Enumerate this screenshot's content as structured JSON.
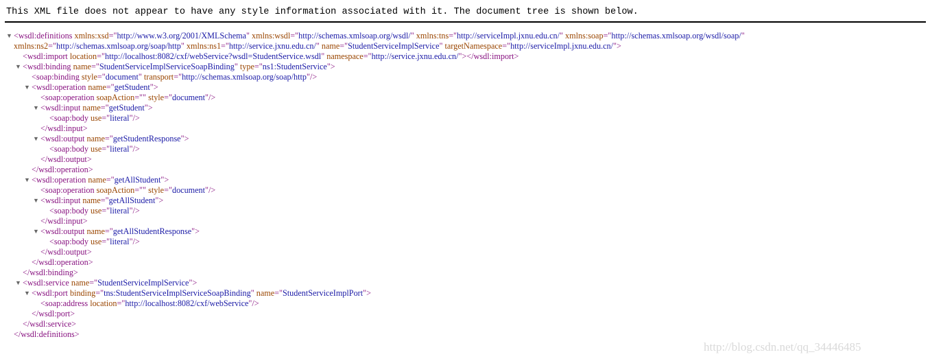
{
  "header": {
    "message": "This XML file does not appear to have any style information associated with it. The document tree is shown below."
  },
  "tree": [
    {
      "indent": 0,
      "toggle": true,
      "parts": [
        [
          "t",
          "<wsdl:definitions"
        ],
        [
          "s",
          " "
        ],
        [
          "a",
          "xmlns:xsd"
        ],
        [
          "t",
          "=\""
        ],
        [
          "v",
          "http://www.w3.org/2001/XMLSchema"
        ],
        [
          "t",
          "\""
        ],
        [
          "s",
          " "
        ],
        [
          "a",
          "xmlns:wsdl"
        ],
        [
          "t",
          "=\""
        ],
        [
          "v",
          "http://schemas.xmlsoap.org/wsdl/"
        ],
        [
          "t",
          "\""
        ],
        [
          "s",
          " "
        ],
        [
          "a",
          "xmlns:tns"
        ],
        [
          "t",
          "=\""
        ],
        [
          "v",
          "http://serviceImpl.jxnu.edu.cn/"
        ],
        [
          "t",
          "\""
        ],
        [
          "s",
          " "
        ],
        [
          "a",
          "xmlns:soap"
        ],
        [
          "t",
          "=\""
        ],
        [
          "v",
          "http://schemas.xmlsoap.org/wsdl/soap/"
        ],
        [
          "t",
          "\""
        ]
      ]
    },
    {
      "indent": 0,
      "toggle": false,
      "parts": [
        [
          "a",
          "xmlns:ns2"
        ],
        [
          "t",
          "=\""
        ],
        [
          "v",
          "http://schemas.xmlsoap.org/soap/http"
        ],
        [
          "t",
          "\""
        ],
        [
          "s",
          " "
        ],
        [
          "a",
          "xmlns:ns1"
        ],
        [
          "t",
          "=\""
        ],
        [
          "v",
          "http://service.jxnu.edu.cn/"
        ],
        [
          "t",
          "\""
        ],
        [
          "s",
          " "
        ],
        [
          "a",
          "name"
        ],
        [
          "t",
          "=\""
        ],
        [
          "v",
          "StudentServiceImplService"
        ],
        [
          "t",
          "\""
        ],
        [
          "s",
          " "
        ],
        [
          "a",
          "targetNamespace"
        ],
        [
          "t",
          "=\""
        ],
        [
          "v",
          "http://serviceImpl.jxnu.edu.cn/"
        ],
        [
          "t",
          "\">"
        ]
      ]
    },
    {
      "indent": 1,
      "toggle": false,
      "parts": [
        [
          "t",
          "<wsdl:import"
        ],
        [
          "s",
          " "
        ],
        [
          "a",
          "location"
        ],
        [
          "t",
          "=\""
        ],
        [
          "v",
          "http://localhost:8082/cxf/webService?wsdl=StudentService.wsdl"
        ],
        [
          "t",
          "\""
        ],
        [
          "s",
          " "
        ],
        [
          "a",
          "namespace"
        ],
        [
          "t",
          "=\""
        ],
        [
          "v",
          "http://service.jxnu.edu.cn/"
        ],
        [
          "t",
          "\"></wsdl:import>"
        ]
      ]
    },
    {
      "indent": 1,
      "toggle": true,
      "parts": [
        [
          "t",
          "<wsdl:binding"
        ],
        [
          "s",
          " "
        ],
        [
          "a",
          "name"
        ],
        [
          "t",
          "=\""
        ],
        [
          "v",
          "StudentServiceImplServiceSoapBinding"
        ],
        [
          "t",
          "\""
        ],
        [
          "s",
          " "
        ],
        [
          "a",
          "type"
        ],
        [
          "t",
          "=\""
        ],
        [
          "v",
          "ns1:StudentService"
        ],
        [
          "t",
          "\">"
        ]
      ]
    },
    {
      "indent": 2,
      "toggle": false,
      "parts": [
        [
          "t",
          "<soap:binding"
        ],
        [
          "s",
          " "
        ],
        [
          "a",
          "style"
        ],
        [
          "t",
          "=\""
        ],
        [
          "v",
          "document"
        ],
        [
          "t",
          "\""
        ],
        [
          "s",
          " "
        ],
        [
          "a",
          "transport"
        ],
        [
          "t",
          "=\""
        ],
        [
          "v",
          "http://schemas.xmlsoap.org/soap/http"
        ],
        [
          "t",
          "\"/>"
        ]
      ]
    },
    {
      "indent": 2,
      "toggle": true,
      "parts": [
        [
          "t",
          "<wsdl:operation"
        ],
        [
          "s",
          " "
        ],
        [
          "a",
          "name"
        ],
        [
          "t",
          "=\""
        ],
        [
          "v",
          "getStudent"
        ],
        [
          "t",
          "\">"
        ]
      ]
    },
    {
      "indent": 3,
      "toggle": false,
      "parts": [
        [
          "t",
          "<soap:operation"
        ],
        [
          "s",
          " "
        ],
        [
          "a",
          "soapAction"
        ],
        [
          "t",
          "=\""
        ],
        [
          "v",
          ""
        ],
        [
          "t",
          "\""
        ],
        [
          "s",
          " "
        ],
        [
          "a",
          "style"
        ],
        [
          "t",
          "=\""
        ],
        [
          "v",
          "document"
        ],
        [
          "t",
          "\"/>"
        ]
      ]
    },
    {
      "indent": 3,
      "toggle": true,
      "parts": [
        [
          "t",
          "<wsdl:input"
        ],
        [
          "s",
          " "
        ],
        [
          "a",
          "name"
        ],
        [
          "t",
          "=\""
        ],
        [
          "v",
          "getStudent"
        ],
        [
          "t",
          "\">"
        ]
      ]
    },
    {
      "indent": 4,
      "toggle": false,
      "parts": [
        [
          "t",
          "<soap:body"
        ],
        [
          "s",
          " "
        ],
        [
          "a",
          "use"
        ],
        [
          "t",
          "=\""
        ],
        [
          "v",
          "literal"
        ],
        [
          "t",
          "\"/>"
        ]
      ]
    },
    {
      "indent": 3,
      "toggle": false,
      "parts": [
        [
          "t",
          "</wsdl:input>"
        ]
      ]
    },
    {
      "indent": 3,
      "toggle": true,
      "parts": [
        [
          "t",
          "<wsdl:output"
        ],
        [
          "s",
          " "
        ],
        [
          "a",
          "name"
        ],
        [
          "t",
          "=\""
        ],
        [
          "v",
          "getStudentResponse"
        ],
        [
          "t",
          "\">"
        ]
      ]
    },
    {
      "indent": 4,
      "toggle": false,
      "parts": [
        [
          "t",
          "<soap:body"
        ],
        [
          "s",
          " "
        ],
        [
          "a",
          "use"
        ],
        [
          "t",
          "=\""
        ],
        [
          "v",
          "literal"
        ],
        [
          "t",
          "\"/>"
        ]
      ]
    },
    {
      "indent": 3,
      "toggle": false,
      "parts": [
        [
          "t",
          "</wsdl:output>"
        ]
      ]
    },
    {
      "indent": 2,
      "toggle": false,
      "parts": [
        [
          "t",
          "</wsdl:operation>"
        ]
      ]
    },
    {
      "indent": 2,
      "toggle": true,
      "parts": [
        [
          "t",
          "<wsdl:operation"
        ],
        [
          "s",
          " "
        ],
        [
          "a",
          "name"
        ],
        [
          "t",
          "=\""
        ],
        [
          "v",
          "getAllStudent"
        ],
        [
          "t",
          "\">"
        ]
      ]
    },
    {
      "indent": 3,
      "toggle": false,
      "parts": [
        [
          "t",
          "<soap:operation"
        ],
        [
          "s",
          " "
        ],
        [
          "a",
          "soapAction"
        ],
        [
          "t",
          "=\""
        ],
        [
          "v",
          ""
        ],
        [
          "t",
          "\""
        ],
        [
          "s",
          " "
        ],
        [
          "a",
          "style"
        ],
        [
          "t",
          "=\""
        ],
        [
          "v",
          "document"
        ],
        [
          "t",
          "\"/>"
        ]
      ]
    },
    {
      "indent": 3,
      "toggle": true,
      "parts": [
        [
          "t",
          "<wsdl:input"
        ],
        [
          "s",
          " "
        ],
        [
          "a",
          "name"
        ],
        [
          "t",
          "=\""
        ],
        [
          "v",
          "getAllStudent"
        ],
        [
          "t",
          "\">"
        ]
      ]
    },
    {
      "indent": 4,
      "toggle": false,
      "parts": [
        [
          "t",
          "<soap:body"
        ],
        [
          "s",
          " "
        ],
        [
          "a",
          "use"
        ],
        [
          "t",
          "=\""
        ],
        [
          "v",
          "literal"
        ],
        [
          "t",
          "\"/>"
        ]
      ]
    },
    {
      "indent": 3,
      "toggle": false,
      "parts": [
        [
          "t",
          "</wsdl:input>"
        ]
      ]
    },
    {
      "indent": 3,
      "toggle": true,
      "parts": [
        [
          "t",
          "<wsdl:output"
        ],
        [
          "s",
          " "
        ],
        [
          "a",
          "name"
        ],
        [
          "t",
          "=\""
        ],
        [
          "v",
          "getAllStudentResponse"
        ],
        [
          "t",
          "\">"
        ]
      ]
    },
    {
      "indent": 4,
      "toggle": false,
      "parts": [
        [
          "t",
          "<soap:body"
        ],
        [
          "s",
          " "
        ],
        [
          "a",
          "use"
        ],
        [
          "t",
          "=\""
        ],
        [
          "v",
          "literal"
        ],
        [
          "t",
          "\"/>"
        ]
      ]
    },
    {
      "indent": 3,
      "toggle": false,
      "parts": [
        [
          "t",
          "</wsdl:output>"
        ]
      ]
    },
    {
      "indent": 2,
      "toggle": false,
      "parts": [
        [
          "t",
          "</wsdl:operation>"
        ]
      ]
    },
    {
      "indent": 1,
      "toggle": false,
      "parts": [
        [
          "t",
          "</wsdl:binding>"
        ]
      ]
    },
    {
      "indent": 1,
      "toggle": true,
      "parts": [
        [
          "t",
          "<wsdl:service"
        ],
        [
          "s",
          " "
        ],
        [
          "a",
          "name"
        ],
        [
          "t",
          "=\""
        ],
        [
          "v",
          "StudentServiceImplService"
        ],
        [
          "t",
          "\">"
        ]
      ]
    },
    {
      "indent": 2,
      "toggle": true,
      "parts": [
        [
          "t",
          "<wsdl:port"
        ],
        [
          "s",
          " "
        ],
        [
          "a",
          "binding"
        ],
        [
          "t",
          "=\""
        ],
        [
          "v",
          "tns:StudentServiceImplServiceSoapBinding"
        ],
        [
          "t",
          "\""
        ],
        [
          "s",
          " "
        ],
        [
          "a",
          "name"
        ],
        [
          "t",
          "=\""
        ],
        [
          "v",
          "StudentServiceImplPort"
        ],
        [
          "t",
          "\">"
        ]
      ]
    },
    {
      "indent": 3,
      "toggle": false,
      "parts": [
        [
          "t",
          "<soap:address"
        ],
        [
          "s",
          " "
        ],
        [
          "a",
          "location"
        ],
        [
          "t",
          "=\""
        ],
        [
          "v",
          "http://localhost:8082/cxf/webService"
        ],
        [
          "t",
          "\"/>"
        ]
      ]
    },
    {
      "indent": 2,
      "toggle": false,
      "parts": [
        [
          "t",
          "</wsdl:port>"
        ]
      ]
    },
    {
      "indent": 1,
      "toggle": false,
      "parts": [
        [
          "t",
          "</wsdl:service>"
        ]
      ]
    },
    {
      "indent": 0,
      "toggle": false,
      "parts": [
        [
          "t",
          "</wsdl:definitions>"
        ]
      ]
    }
  ],
  "watermark": "http://blog.csdn.net/qq_34446485",
  "colors": {
    "tag": "#881280",
    "attribute": "#994500",
    "value": "#1a1aa6",
    "toggle": "#666666"
  },
  "icons": {
    "toggle": "triangle-down-icon"
  }
}
